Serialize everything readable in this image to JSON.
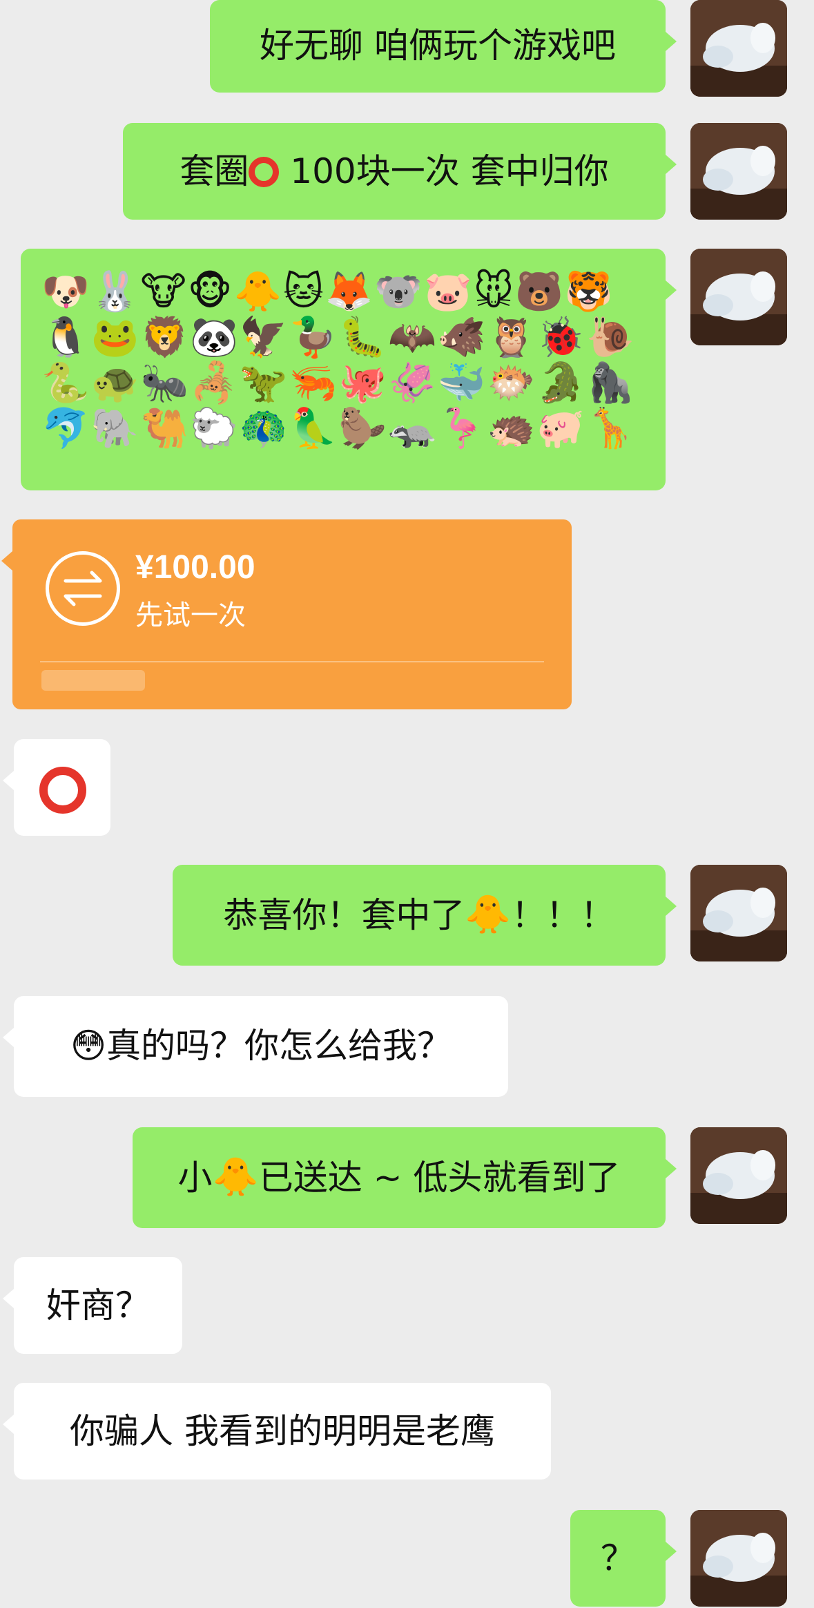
{
  "messages": {
    "m1": "好无聊 咱俩玩个游戏吧",
    "m2_pre": "套圈",
    "m2_post": " 100块一次 套中归你",
    "m3_emojis": "🐶🐰🐮🐵🐥🐱🦊🐨🐷🐭🐻🐯🐧🐸🦁🐼🦅🦆🐛🦇🐗🦉🐞🐌🐍🐢🐜🦂🦖🦐🐙🦑🐳🐡🐊🦍🐬🐘🐫🐑🦚🦜🦫🦡🦩🦔🐖🦒",
    "transfer": {
      "amount": "¥100.00",
      "note": "先试一次"
    },
    "m5": "⭕",
    "m6_pre": "恭喜你！套中了",
    "m6_emoji": "🐥",
    "m6_post": "！！！",
    "m7_emoji": "😳",
    "m7_text": "真的吗？你怎么给我？",
    "m8_pre": "小",
    "m8_emoji": "🐥",
    "m8_post": "已送达 ~ 低头就看到了",
    "m9": "奸商？",
    "m10": "你骗人 我看到的明明是老鹰",
    "m11": "？"
  },
  "colors": {
    "self_bubble": "#95ec69",
    "other_bubble": "#ffffff",
    "transfer": "#f9a03f",
    "background": "#ececec"
  },
  "icons": {
    "avatar": "cat-avatar",
    "transfer": "transfer-arrows-icon",
    "ring": "red-ring-icon"
  }
}
